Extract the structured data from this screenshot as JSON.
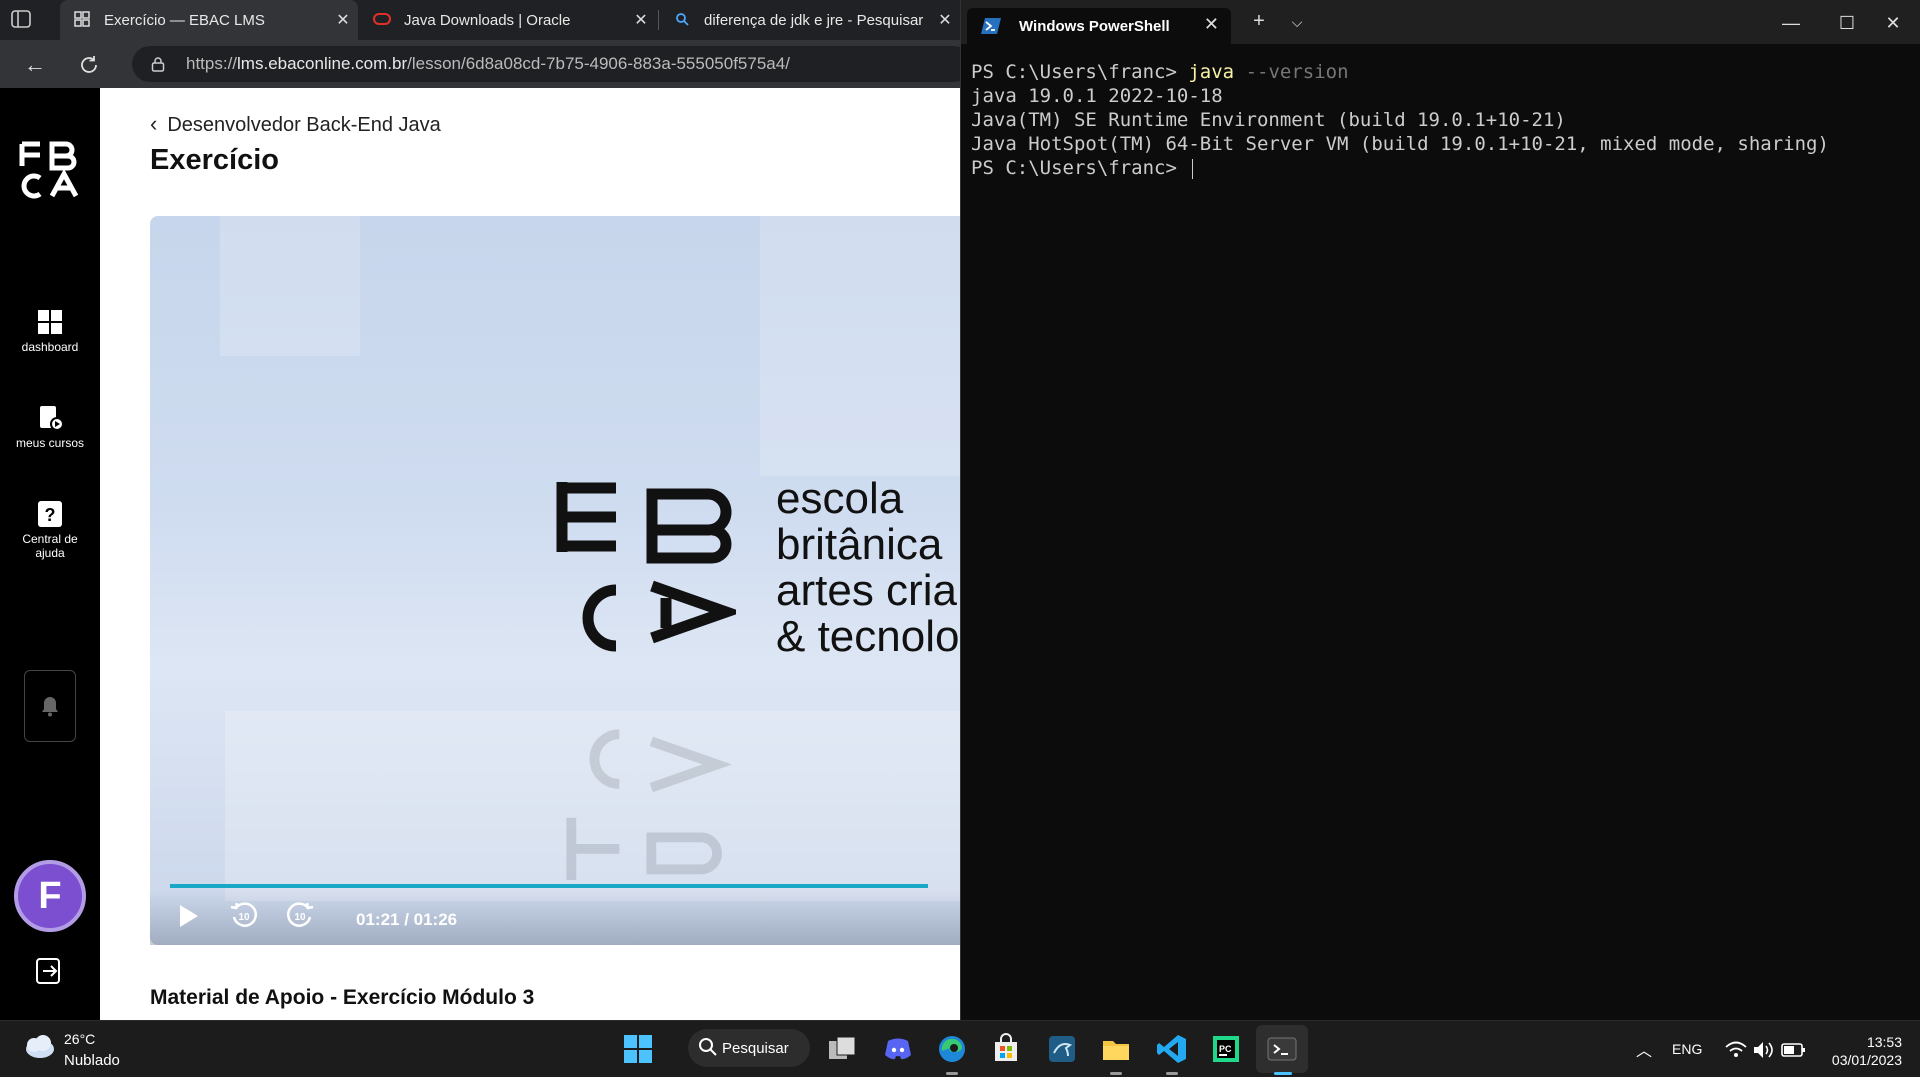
{
  "browser": {
    "tabs": [
      {
        "label": "Exercício — EBAC LMS",
        "icon": "ebac-favicon",
        "active": true
      },
      {
        "label": "Java Downloads | Oracle",
        "icon": "oracle-favicon",
        "active": false
      },
      {
        "label": "diferença de jdk e jre - Pesquisar",
        "icon": "bing-search-favicon",
        "active": false
      }
    ],
    "url_scheme": "https://",
    "url_host": "lms.ebaconline.com.br",
    "url_path": "/lesson/6d8a08cd-7b75-4906-883a-555050f575a4/"
  },
  "lms": {
    "sidebar": [
      {
        "label": "dashboard",
        "icon": "dashboard-icon"
      },
      {
        "label": "meus cursos",
        "icon": "courses-icon"
      },
      {
        "label": "Central de ajuda",
        "icon": "help-icon"
      }
    ],
    "avatar_letter": "F",
    "breadcrumb": "Desenvolvedor Back-End Java",
    "title": "Exercício",
    "video": {
      "brand_lines": [
        "escola",
        "britânica",
        "artes cria",
        "& tecnolo"
      ],
      "time": "01:21 / 01:26",
      "progress": 0.96
    },
    "material_title": "Material de Apoio - Exercício Módulo 3"
  },
  "powershell": {
    "tab_title": "Windows PowerShell",
    "prompt": "PS C:\\Users\\franc> ",
    "command": "java",
    "param": "--version",
    "output": [
      "java 19.0.1 2022-10-18",
      "Java(TM) SE Runtime Environment (build 19.0.1+10-21)",
      "Java HotSpot(TM) 64-Bit Server VM (build 19.0.1+10-21, mixed mode, sharing)"
    ],
    "current_prompt": "PS C:\\Users\\franc> "
  },
  "taskbar": {
    "temperature": "26°C",
    "condition": "Nublado",
    "search_label": "Pesquisar",
    "language": "ENG",
    "time": "13:53",
    "date": "03/01/2023"
  },
  "colors": {
    "accent_progress": "#18a7c4",
    "avatar": "#7b4fd0",
    "ps_command": "#f9f1a5"
  }
}
